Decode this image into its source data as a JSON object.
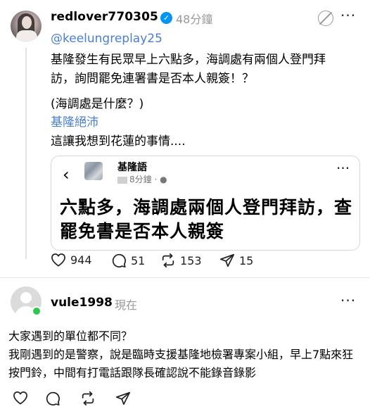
{
  "post": {
    "username": "redlover770305",
    "time": "48分鐘",
    "mention": "@keelungreplay25",
    "text": "基隆發生有民眾早上六點多，海調處有兩個人登門拜訪，詢問罷免連署書是否本人親簽！？",
    "paren_text": "(海調處是什麼？)",
    "tag": "基隆絕沛",
    "text2": "這讓我想到花蓮的事情....",
    "quote": {
      "author": "基隆語",
      "time": "8分鐘 ·",
      "headline": "六點多，海調處兩個人登門拜訪，查罷免書是否本人親簽"
    },
    "stats": {
      "likes": "944",
      "comments": "51",
      "reposts": "153",
      "shares": "15"
    }
  },
  "comment": {
    "username": "vule1998",
    "time": "現在",
    "line1": "大家遇到的單位都不同？",
    "line2": "我剛遇到的是警察，說是臨時支援基隆地檢署專案小組，早上7點來狂按門鈴，中間有打電話跟隊長確認說不能錄音錄影"
  },
  "icons": {
    "verified": "verified-badge-icon",
    "mute": "mute-icon",
    "more": "more-icon",
    "back": "back-icon",
    "like": "heart-icon",
    "comment": "comment-icon",
    "repost": "repost-icon",
    "share": "send-icon",
    "online": "online-dot"
  },
  "colors": {
    "link": "#4a7fd0",
    "verified": "#0095f6",
    "online": "#2cc84d",
    "muted": "#999999"
  }
}
